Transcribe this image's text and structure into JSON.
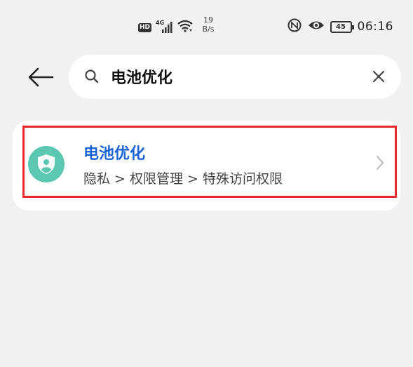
{
  "status_bar": {
    "hd": "HD",
    "network_gen": "4G",
    "speed_value": "19",
    "speed_unit": "B/s",
    "battery": "45",
    "time": "06:16",
    "icons": [
      "signal-icon",
      "wifi-icon",
      "nfc-icon",
      "eye-icon",
      "battery-icon"
    ]
  },
  "search": {
    "query": "电池优化",
    "placeholder": ""
  },
  "results": [
    {
      "title": "电池优化",
      "path": "隐私 > 权限管理 > 特殊访问权限",
      "icon": "privacy-shield-icon",
      "icon_color": "#5cc8b2",
      "highlighted": true
    }
  ],
  "colors": {
    "accent_text": "#1a63d8",
    "highlight_border": "#e8282c",
    "background": "#f1f1f1"
  }
}
